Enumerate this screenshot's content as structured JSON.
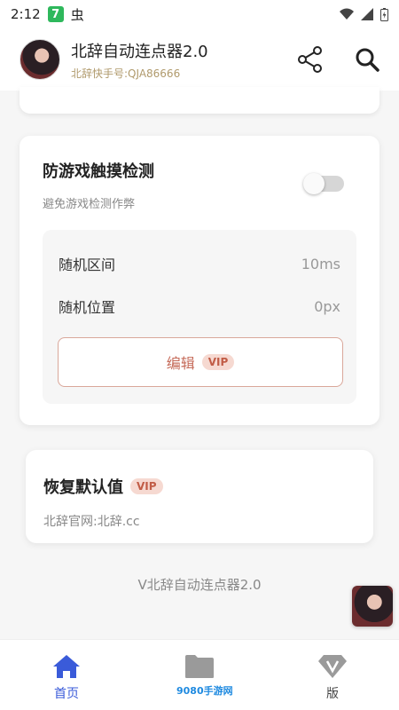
{
  "status_bar": {
    "time": "2:12",
    "app_badge": "7",
    "extra_icon": "虫"
  },
  "header": {
    "title": "北辞自动连点器2.0",
    "subtitle": "北辞快手号:QJA86666",
    "share_icon": "share-icon",
    "search_icon": "search-icon"
  },
  "anti_detect": {
    "title": "防游戏触摸检测",
    "desc": "避免游戏检测作弊",
    "enabled": false,
    "rows": [
      {
        "label": "随机区间",
        "value": "10ms"
      },
      {
        "label": "随机位置",
        "value": "0px"
      }
    ],
    "edit_label": "编辑",
    "vip_badge": "VIP"
  },
  "reset": {
    "title": "恢复默认值",
    "vip_badge": "VIP",
    "desc": "北辞官网:北辞.cc"
  },
  "version_text": "V北辞自动连点器2.0",
  "nav": {
    "home": "首页",
    "files": "",
    "version": "版"
  },
  "watermark": "9080手游网",
  "colors": {
    "accent": "#3a5bd9",
    "vip": "#c15c46",
    "subtitle": "#b09a6c"
  }
}
